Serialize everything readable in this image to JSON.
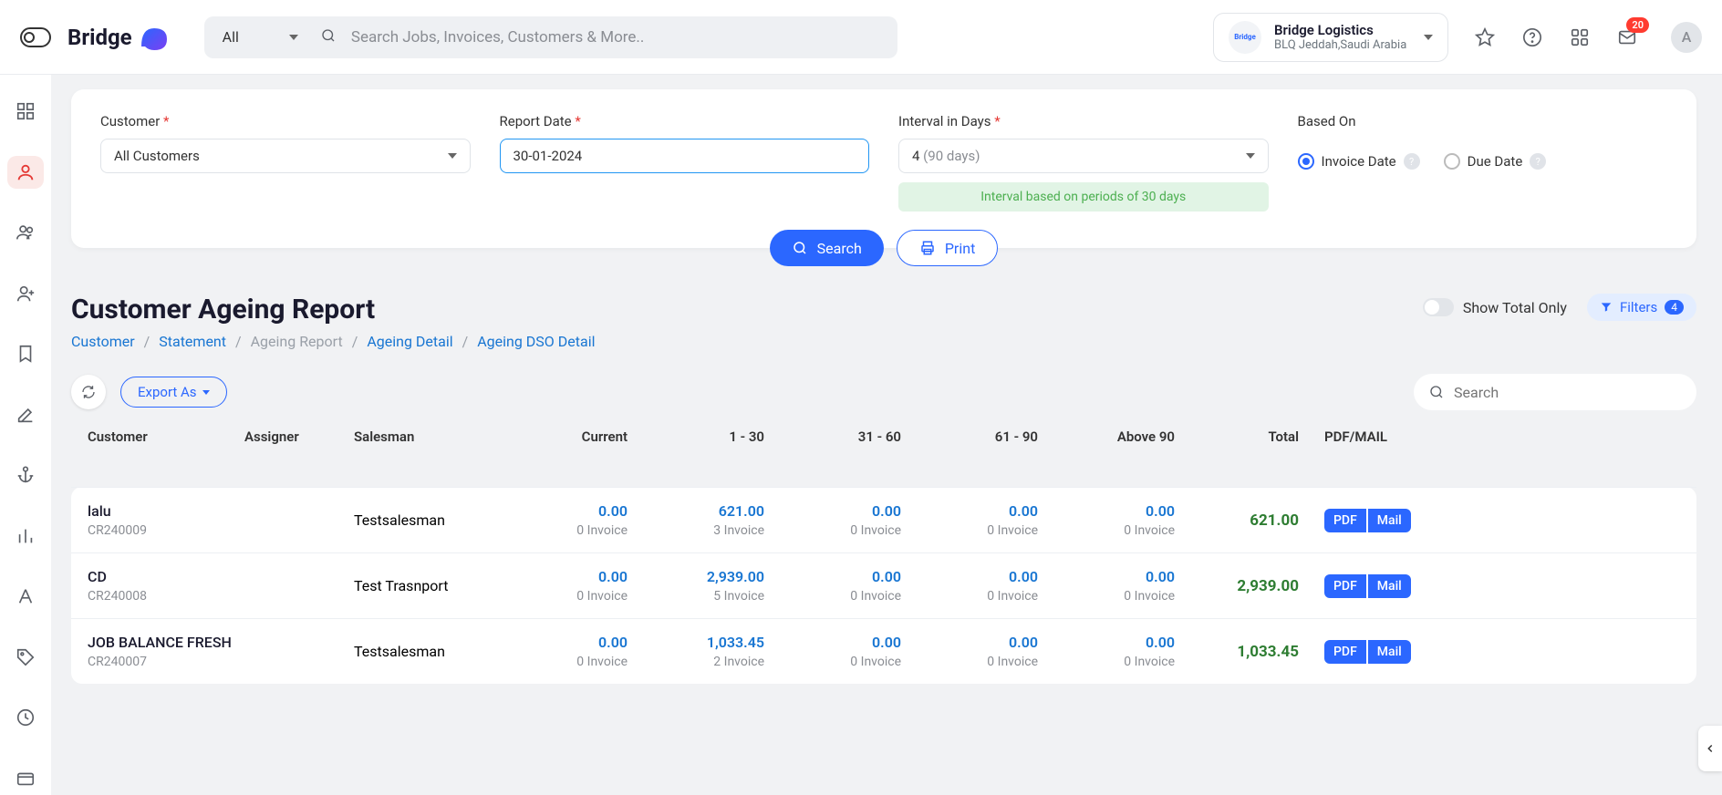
{
  "search": {
    "selector": "All",
    "placeholder": "Search Jobs, Invoices, Customers & More.."
  },
  "company": {
    "name": "Bridge Logistics",
    "sub": "BLQ Jeddah,Saudi Arabia",
    "logo_text": "Bridge"
  },
  "notifications": {
    "count": "20"
  },
  "avatar_letter": "A",
  "filters": {
    "customer_label": "Customer",
    "customer_value": "All Customers",
    "report_date_label": "Report Date",
    "report_date_value": "30-01-2024",
    "interval_label": "Interval in Days",
    "interval_value_num": "4",
    "interval_value_days": "(90 days)",
    "interval_note": "Interval based on periods of 30 days",
    "based_on_label": "Based On",
    "radio_invoice": "Invoice Date",
    "radio_due": "Due Date",
    "search_btn": "Search",
    "print_btn": "Print"
  },
  "page": {
    "title": "Customer Ageing Report",
    "crumb_customer": "Customer",
    "crumb_statement": "Statement",
    "crumb_ageing_report": "Ageing Report",
    "crumb_ageing_detail": "Ageing Detail",
    "crumb_dso": "Ageing DSO Detail",
    "show_total": "Show Total Only",
    "filters_chip": "Filters",
    "filters_count": "4",
    "export": "Export As",
    "table_search_placeholder": "Search"
  },
  "table": {
    "headers": {
      "customer": "Customer",
      "assigner": "Assigner",
      "salesman": "Salesman",
      "current": "Current",
      "r1": "1 - 30",
      "r2": "31 - 60",
      "r3": "61 - 90",
      "r4": "Above 90",
      "total": "Total",
      "actions": "PDF/MAIL"
    },
    "rows": [
      {
        "name": "lalu",
        "code": "CR240009",
        "assigner": "",
        "salesman": "Testsalesman",
        "current_amt": "0.00",
        "current_inv": "0 Invoice",
        "r1_amt": "621.00",
        "r1_inv": "3 Invoice",
        "r2_amt": "0.00",
        "r2_inv": "0 Invoice",
        "r3_amt": "0.00",
        "r3_inv": "0 Invoice",
        "r4_amt": "0.00",
        "r4_inv": "0 Invoice",
        "total": "621.00",
        "pdf": "PDF",
        "mail": "Mail"
      },
      {
        "name": "CD",
        "code": "CR240008",
        "assigner": "",
        "salesman": "Test Trasnport",
        "current_amt": "0.00",
        "current_inv": "0 Invoice",
        "r1_amt": "2,939.00",
        "r1_inv": "5 Invoice",
        "r2_amt": "0.00",
        "r2_inv": "0 Invoice",
        "r3_amt": "0.00",
        "r3_inv": "0 Invoice",
        "r4_amt": "0.00",
        "r4_inv": "0 Invoice",
        "total": "2,939.00",
        "pdf": "PDF",
        "mail": "Mail"
      },
      {
        "name": "JOB BALANCE FRESH",
        "code": "CR240007",
        "assigner": "",
        "salesman": "Testsalesman",
        "current_amt": "0.00",
        "current_inv": "0 Invoice",
        "r1_amt": "1,033.45",
        "r1_inv": "2 Invoice",
        "r2_amt": "0.00",
        "r2_inv": "0 Invoice",
        "r3_amt": "0.00",
        "r3_inv": "0 Invoice",
        "r4_amt": "0.00",
        "r4_inv": "0 Invoice",
        "total": "1,033.45",
        "pdf": "PDF",
        "mail": "Mail"
      }
    ]
  }
}
